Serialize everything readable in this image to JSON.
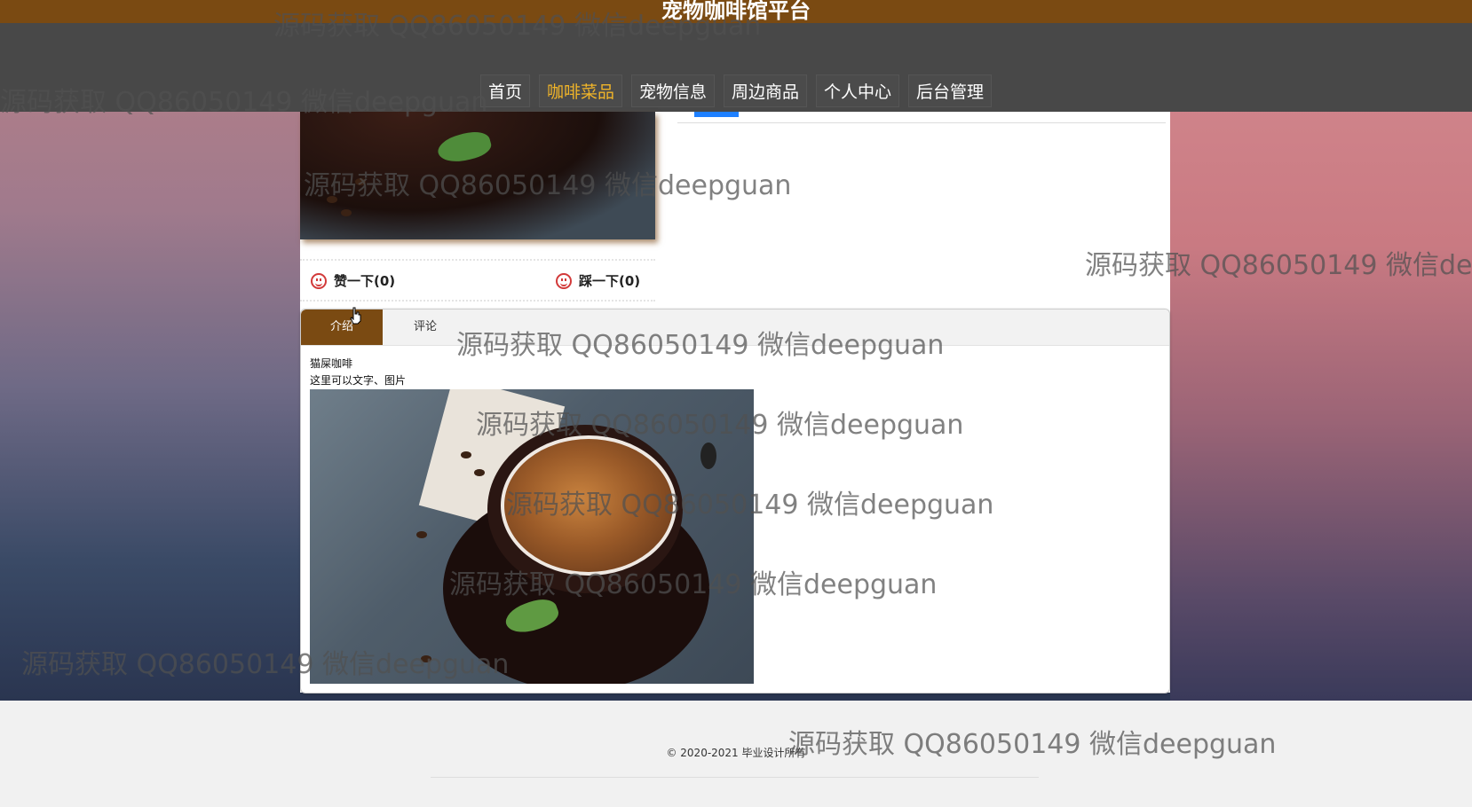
{
  "site": {
    "title": "宠物咖啡馆平台"
  },
  "nav": {
    "items": [
      {
        "label": "首页"
      },
      {
        "label": "咖啡菜品"
      },
      {
        "label": "宠物信息"
      },
      {
        "label": "周边商品"
      },
      {
        "label": "个人中心"
      },
      {
        "label": "后台管理"
      }
    ],
    "active_index": 1
  },
  "votes": {
    "like_label": "赞一下(0)",
    "dislike_label": "踩一下(0)"
  },
  "tabs": {
    "intro": "介绍",
    "comments": "评论"
  },
  "detail": {
    "name": "猫屎咖啡",
    "description": "这里可以文字、图片"
  },
  "footer": {
    "copyright": "© 2020-2021 毕业设计所有"
  },
  "watermark": {
    "text": "源码获取 QQ86050149 微信deepguan"
  },
  "colors": {
    "brand": "#7a4a12",
    "nav_bg": "#484848",
    "active_nav": "#f0b429",
    "accent_blue": "#1e80ff"
  }
}
